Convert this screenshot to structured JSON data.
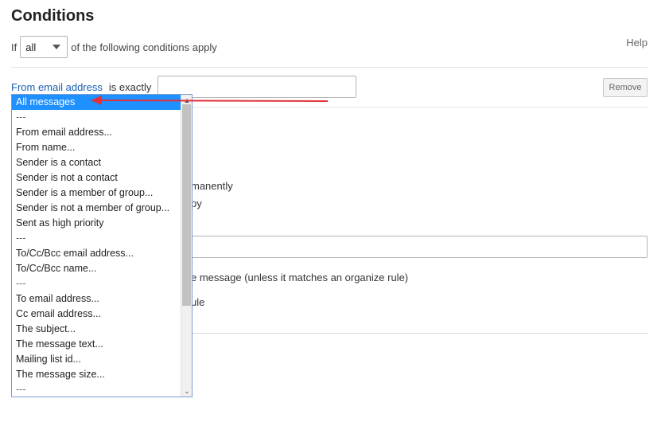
{
  "page": {
    "title": "Conditions",
    "help_label": "Help"
  },
  "condition_line": {
    "if_label": "If",
    "match_select_value": "all",
    "following_label": "of the following conditions apply"
  },
  "condition_row": {
    "field_link": "From email address",
    "operator_label": "is exactly",
    "value_input": "",
    "remove_label": "Remove"
  },
  "background_texts": {
    "t1": "manently",
    "t2": "py",
    "t3": "e message (unless it matches an organize rule)",
    "t4": "ule"
  },
  "dropdown": {
    "options": [
      "All messages",
      "---",
      "From email address...",
      "From name...",
      "Sender is a contact",
      "Sender is not a contact",
      "Sender is a member of group...",
      "Sender is not a member of group...",
      "Sent as high priority",
      "---",
      "To/Cc/Bcc email address...",
      "To/Cc/Bcc name...",
      "---",
      "To email address...",
      "Cc email address...",
      "The subject...",
      "The message text...",
      "Mailing list id...",
      "The message size...",
      "---"
    ],
    "selected_index": 0,
    "scroll_up_icon": "▲",
    "scroll_down_icon": "⌄"
  },
  "colors": {
    "link": "#1a5fb4",
    "selection": "#1e90ff",
    "annotation_arrow": "#e0303a"
  }
}
